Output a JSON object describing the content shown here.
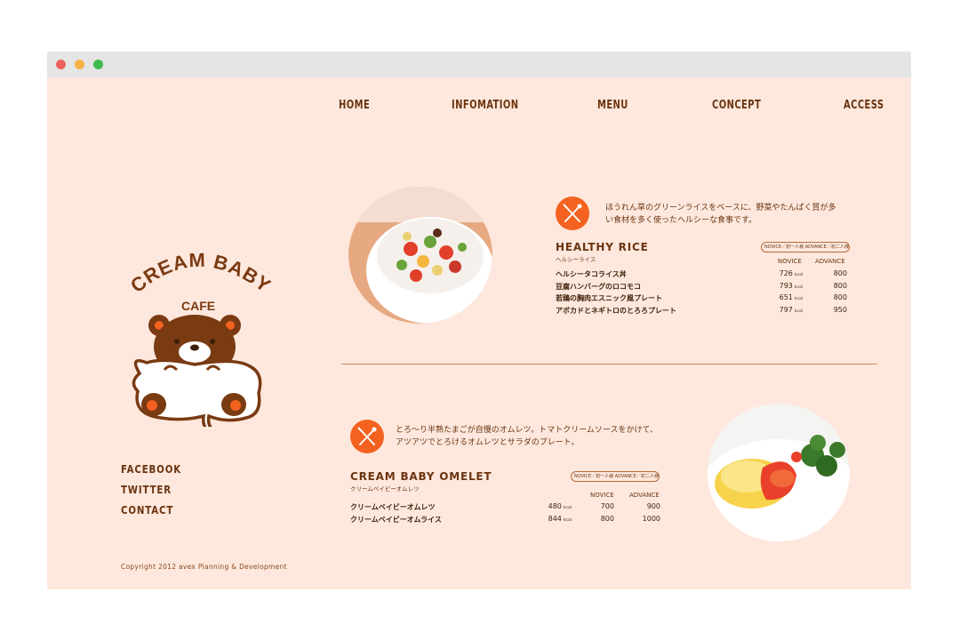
{
  "nav": {
    "home": "HOME",
    "information": "INFOMATION",
    "menu": "MENU",
    "concept": "CONCEPT",
    "access": "ACCESS"
  },
  "logo": {
    "name": "CREAM BABY",
    "sub": "CAFE"
  },
  "social": {
    "facebook": "FACEBOOK",
    "twitter": "TWITTER",
    "contact": "CONTACT"
  },
  "copyright": "Copyright 2012 avex Planning & Development",
  "dishes": [
    {
      "title": "HEALTHY RICE",
      "subtitle": "ヘルシーライス",
      "description_line1": "ほうれん草のグリーンライスをベースに、野菜やたんぱく質が多",
      "description_line2": "い食材を多く使ったヘルシーな食事です。",
      "tag": "NOVICE／初一人様 ADVANCE／初二人様",
      "col_novice": "NOVICE",
      "col_advance": "ADVANCE",
      "items": [
        {
          "name": "ヘルシータコライス丼",
          "kcal": "726",
          "unit": "kcal",
          "advance": "800"
        },
        {
          "name": "豆腐ハンバーグのロコモコ",
          "kcal": "793",
          "unit": "kcal",
          "advance": "800"
        },
        {
          "name": "若鶏の胸肉エスニック風プレート",
          "kcal": "651",
          "unit": "kcal",
          "advance": "800"
        },
        {
          "name": "アボカドとネギトロのとろろプレート",
          "kcal": "797",
          "unit": "kcal",
          "advance": "950"
        }
      ]
    },
    {
      "title": "CREAM BABY OMELET",
      "subtitle": "クリームベイビーオムレツ",
      "description_line1": "とろ～り半熟たまごが自慢のオムレツ。トマトクリームソースをかけて、",
      "description_line2": "アツアツでとろけるオムレツとサラダのプレート。",
      "tag": "NOVICE／初一人様 ADVANCE／初二人様",
      "col_novice": "NOVICE",
      "col_advance": "ADVANCE",
      "items": [
        {
          "name": "クリームベイビーオムレツ",
          "kcal": "480",
          "unit": "kcal",
          "novice": "700",
          "advance": "900"
        },
        {
          "name": "クリームベイビーオムライス",
          "kcal": "844",
          "unit": "kcal",
          "novice": "800",
          "advance": "1000"
        }
      ]
    }
  ],
  "colors": {
    "background": "#fee8dd",
    "brown": "#6b3410",
    "accent": "#f3621f"
  },
  "icons": [
    "fork-knife-icon",
    "bear-logo-icon"
  ]
}
